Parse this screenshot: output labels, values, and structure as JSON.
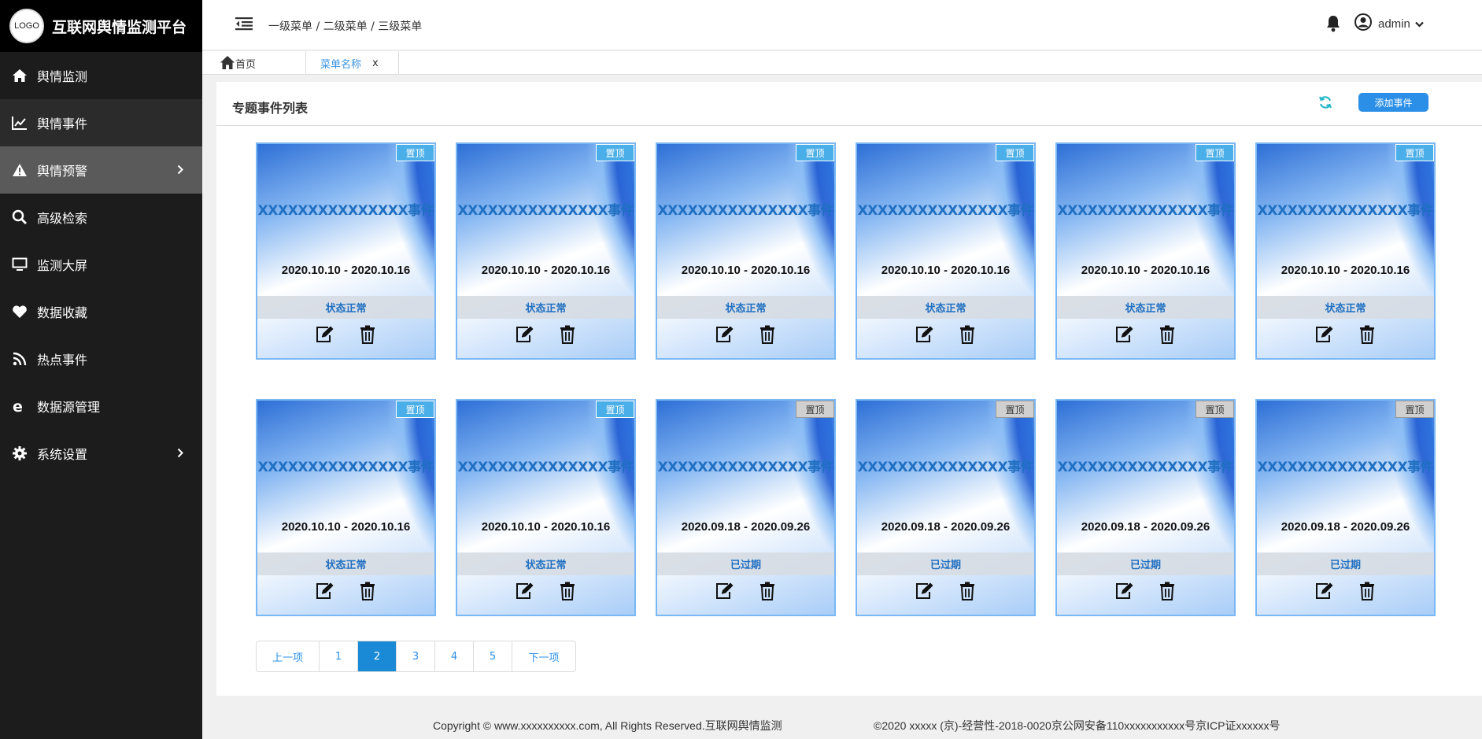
{
  "app": {
    "logo_text": "LOGO",
    "title": "互联网舆情监测平台"
  },
  "sidebar": {
    "items": [
      {
        "label": "舆情监测",
        "icon": "home-icon"
      },
      {
        "label": "舆情事件",
        "icon": "chart-line-icon"
      },
      {
        "label": "舆情预警",
        "icon": "warning-icon",
        "has_submenu": true
      },
      {
        "label": "高级检索",
        "icon": "search-icon"
      },
      {
        "label": "监测大屏",
        "icon": "monitor-icon"
      },
      {
        "label": "数据收藏",
        "icon": "heart-icon"
      },
      {
        "label": "热点事件",
        "icon": "rss-icon"
      },
      {
        "label": "数据源管理",
        "icon": "ie-icon"
      },
      {
        "label": "系统设置",
        "icon": "gear-icon",
        "has_submenu": true
      }
    ]
  },
  "header": {
    "breadcrumb": "一级菜单 / 二级菜单 / 三级菜单",
    "username": "admin"
  },
  "tabs": {
    "home": "首页",
    "current": "菜单名称",
    "close": "x"
  },
  "panel": {
    "title": "专题事件列表",
    "add_button": "添加事件"
  },
  "cards": [
    {
      "pin": "置顶",
      "pinned": true,
      "title": "XXXXXXXXXXXXXXX事件",
      "date": "2020.10.10 - 2020.10.16",
      "status": "状态正常"
    },
    {
      "pin": "置顶",
      "pinned": true,
      "title": "XXXXXXXXXXXXXXX事件",
      "date": "2020.10.10 - 2020.10.16",
      "status": "状态正常"
    },
    {
      "pin": "置顶",
      "pinned": true,
      "title": "XXXXXXXXXXXXXXX事件",
      "date": "2020.10.10 - 2020.10.16",
      "status": "状态正常"
    },
    {
      "pin": "置顶",
      "pinned": true,
      "title": "XXXXXXXXXXXXXXX事件",
      "date": "2020.10.10 - 2020.10.16",
      "status": "状态正常"
    },
    {
      "pin": "置顶",
      "pinned": true,
      "title": "XXXXXXXXXXXXXXX事件",
      "date": "2020.10.10 - 2020.10.16",
      "status": "状态正常"
    },
    {
      "pin": "置顶",
      "pinned": true,
      "title": "XXXXXXXXXXXXXXX事件",
      "date": "2020.10.10 - 2020.10.16",
      "status": "状态正常"
    },
    {
      "pin": "置顶",
      "pinned": true,
      "title": "XXXXXXXXXXXXXXX事件",
      "date": "2020.10.10 - 2020.10.16",
      "status": "状态正常"
    },
    {
      "pin": "置顶",
      "pinned": true,
      "title": "XXXXXXXXXXXXXXX事件",
      "date": "2020.10.10 - 2020.10.16",
      "status": "状态正常"
    },
    {
      "pin": "置顶",
      "pinned": false,
      "title": "XXXXXXXXXXXXXXX事件",
      "date": "2020.09.18 - 2020.09.26",
      "status": "已过期"
    },
    {
      "pin": "置顶",
      "pinned": false,
      "title": "XXXXXXXXXXXXXXX事件",
      "date": "2020.09.18 - 2020.09.26",
      "status": "已过期"
    },
    {
      "pin": "置顶",
      "pinned": false,
      "title": "XXXXXXXXXXXXXXX事件",
      "date": "2020.09.18 - 2020.09.26",
      "status": "已过期"
    },
    {
      "pin": "置顶",
      "pinned": false,
      "title": "XXXXXXXXXXXXXXX事件",
      "date": "2020.09.18 - 2020.09.26",
      "status": "已过期"
    }
  ],
  "pagination": {
    "prev": "上一项",
    "pages": [
      "1",
      "2",
      "3",
      "4",
      "5"
    ],
    "current": "2",
    "next": "下一项"
  },
  "footer": {
    "copyright": "Copyright © www.xxxxxxxxxx.com, All Rights Reserved.互联网舆情监测",
    "license": "©2020 xxxxx (京)-经营性-2018-0020京公网安备110xxxxxxxxxxx号京ICP证xxxxxx号"
  },
  "colors": {
    "sidebar_bg": "#1c1c1c",
    "active_item": "#5a5a5a",
    "accent": "#2b8fe8",
    "pin_active": "#4aaee8",
    "pin_inactive": "#d0d0d0"
  }
}
